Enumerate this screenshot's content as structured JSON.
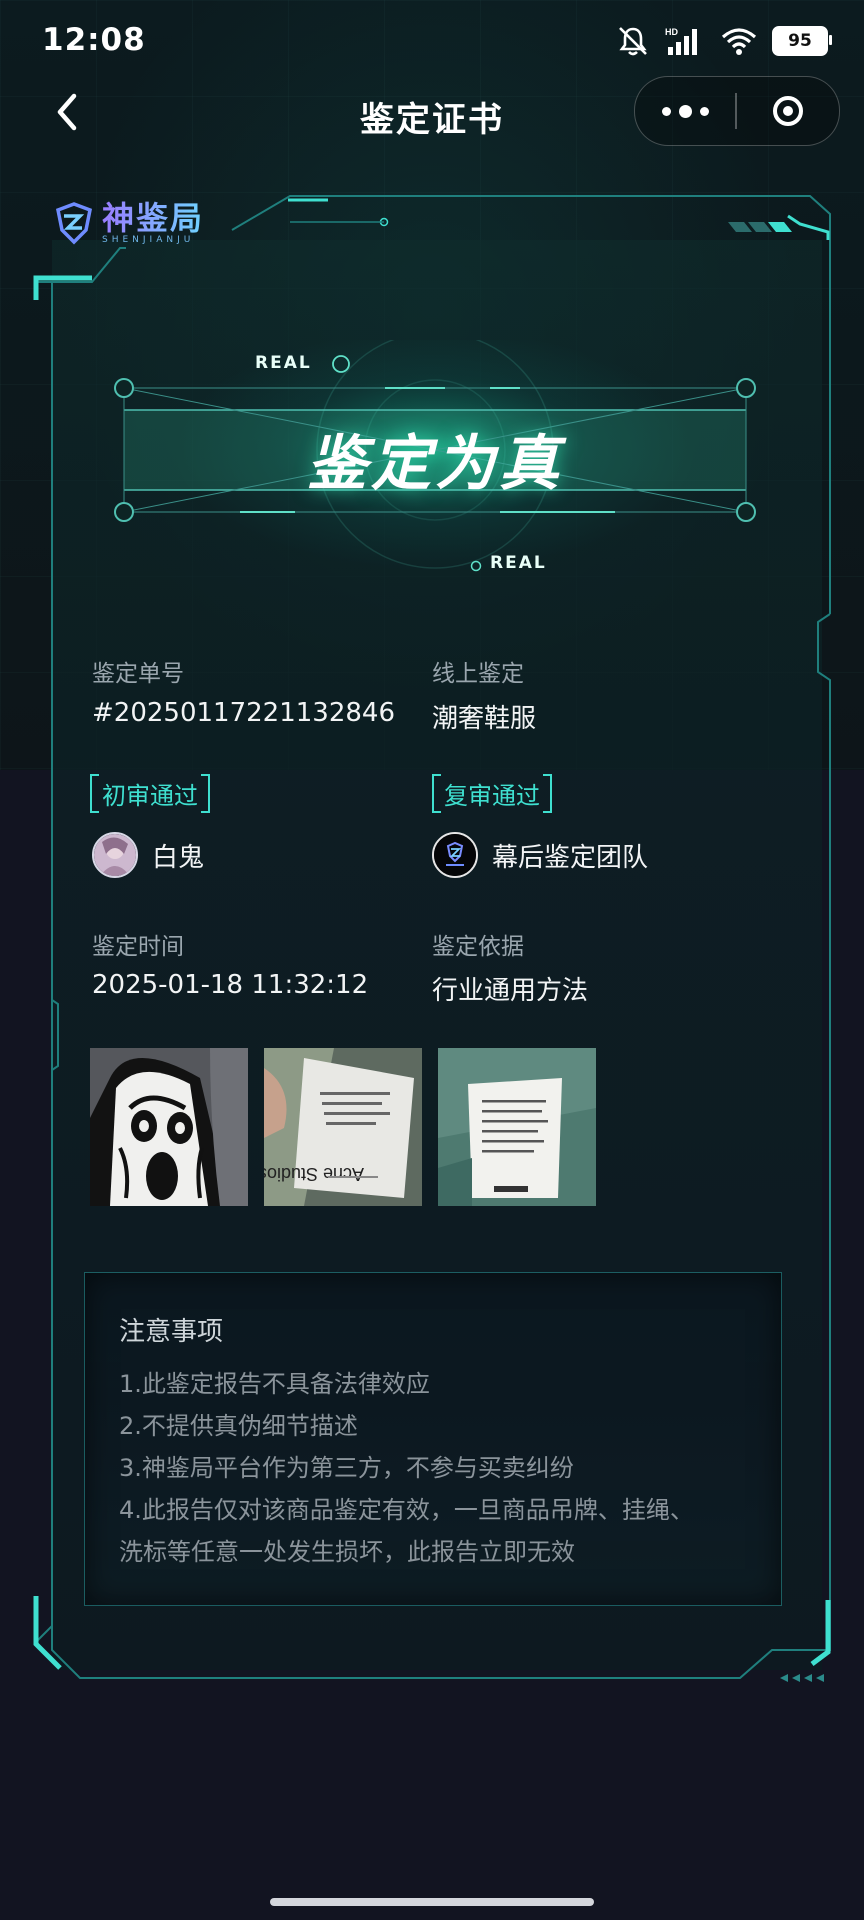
{
  "status_bar": {
    "time": "12:08",
    "battery": "95",
    "network": "HD"
  },
  "nav": {
    "title": "鉴定证书"
  },
  "brand": {
    "name_cn": "神鉴局",
    "name_en": "SHENJIANJU"
  },
  "banner": {
    "title": "鉴定为真",
    "tag_top": "REAL",
    "tag_bottom": "REAL"
  },
  "info": {
    "order_label": "鉴定单号",
    "order_value": "#20250117221132846",
    "mode_label": "线上鉴定",
    "mode_value": "潮奢鞋服",
    "first_review_tag": "初审通过",
    "first_reviewer": "白鬼",
    "second_review_tag": "复审通过",
    "second_reviewer": "幕后鉴定团队",
    "time_label": "鉴定时间",
    "time_value": "2025-01-18 11:32:12",
    "basis_label": "鉴定依据",
    "basis_value": "行业通用方法"
  },
  "photos": [
    {
      "subject": "graphic-print"
    },
    {
      "subject": "care-label-acne-studios",
      "label_text": "Acne Studios"
    },
    {
      "subject": "care-label"
    }
  ],
  "notice": {
    "title": "注意事项",
    "items": [
      "1.此鉴定报告不具备法律效应",
      "2.不提供真伪细节描述",
      "3.神鉴局平台作为第三方，不参与买卖纠纷",
      "4.此报告仅对该商品鉴定有效，一旦商品吊牌、挂绳、",
      "洗标等任意一处发生损坏，此报告立即无效"
    ]
  },
  "colors": {
    "accent": "#3fe0d0",
    "background": "#121421",
    "card": "#0e2a2c"
  }
}
